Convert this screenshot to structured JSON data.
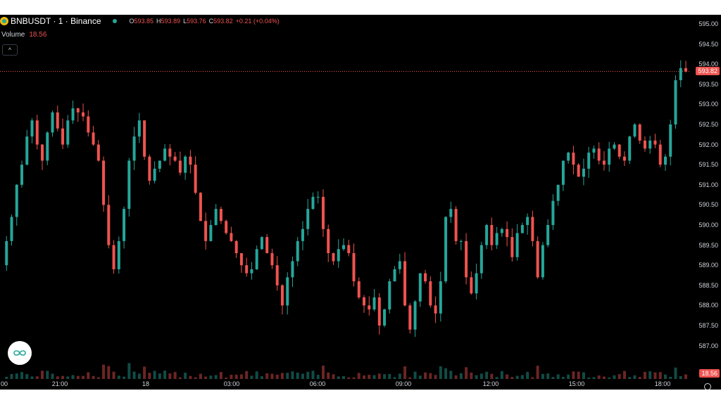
{
  "symbol": {
    "title": "BNBUSDT · 1 · Binance",
    "icon": "bnb-coin-icon"
  },
  "ohlc": {
    "o_label": "O",
    "o_value": "593.85",
    "h_label": "H",
    "h_value": "593.89",
    "l_label": "L",
    "l_value": "593.76",
    "c_label": "C",
    "c_value": "593.82",
    "change": "+0.21 (+0.04%)"
  },
  "volume": {
    "label": "Volume",
    "value": "18.56"
  },
  "price_axis": {
    "labels": [
      "595.00",
      "594.50",
      "594.00",
      "593.50",
      "593.00",
      "592.50",
      "592.00",
      "591.50",
      "591.00",
      "590.50",
      "590.00",
      "589.50",
      "589.00",
      "588.50",
      "588.00",
      "587.50",
      "587.00"
    ],
    "current_price": "593.82",
    "current_volume": "18.56"
  },
  "time_axis": {
    "labels": [
      "00",
      "21:00",
      "18",
      "03:00",
      "06:00",
      "09:00",
      "12:00",
      "15:00",
      "18:00"
    ]
  },
  "colors": {
    "up": "#26a69a",
    "down": "#ef5350",
    "background": "#000000",
    "text": "#d1d4dc",
    "bnb": "#f0b90b"
  },
  "chart_data": {
    "type": "candlestick",
    "ylim": [
      586.7,
      595.2
    ],
    "series": [
      {
        "name": "BNBUSDT",
        "values": [
          589.0,
          589.6,
          590.2,
          591.0,
          591.5,
          592.2,
          592.6,
          592.0,
          591.6,
          592.3,
          592.8,
          592.4,
          592.0,
          592.6,
          592.9,
          592.8,
          592.7,
          592.3,
          592.0,
          591.6,
          590.5,
          589.5,
          588.9,
          589.6,
          590.4,
          591.6,
          592.2,
          592.6,
          591.7,
          591.1,
          591.4,
          591.6,
          591.9,
          591.7,
          591.6,
          591.3,
          591.7,
          591.5,
          590.8,
          590.1,
          589.6,
          590.0,
          590.4,
          590.1,
          589.8,
          589.6,
          589.3,
          589.0,
          588.8,
          588.9,
          589.4,
          589.7,
          589.3,
          589.0,
          588.5,
          588.0,
          588.7,
          589.1,
          589.6,
          589.9,
          590.4,
          590.7,
          590.7,
          589.9,
          589.3,
          589.1,
          589.4,
          589.5,
          589.3,
          588.6,
          588.2,
          588.0,
          587.9,
          588.2,
          587.5,
          587.9,
          588.6,
          588.9,
          589.1,
          588.0,
          587.4,
          588.1,
          588.8,
          588.6,
          588.0,
          587.8,
          588.6,
          590.2,
          590.4,
          589.6,
          589.6,
          588.7,
          588.3,
          588.8,
          589.5,
          590.0,
          589.5,
          589.8,
          589.9,
          589.7,
          589.2,
          589.8,
          590.0,
          590.2,
          589.6,
          588.7,
          589.5,
          590.0,
          590.6,
          591.0,
          591.6,
          591.8,
          591.5,
          591.2,
          591.4,
          591.8,
          591.9,
          591.6,
          591.5,
          591.9,
          592.0,
          591.7,
          591.6,
          592.2,
          592.5,
          592.1,
          591.9,
          592.1,
          592.0,
          591.5,
          591.7,
          592.5,
          593.6,
          593.9,
          593.82
        ]
      }
    ]
  }
}
